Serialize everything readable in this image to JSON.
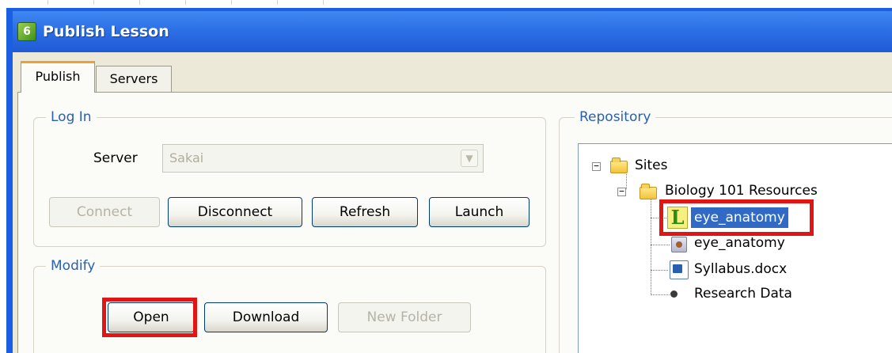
{
  "window": {
    "title": "Publish Lesson",
    "app_icon": "app-logo-icon",
    "app_icon_glyph": "6",
    "titlebar_color": "#2d70e6"
  },
  "tabs": [
    {
      "label": "Publish",
      "active": true
    },
    {
      "label": "Servers",
      "active": false
    }
  ],
  "login": {
    "group_label": "Log In",
    "server_label": "Server",
    "server_value": "Sakai",
    "buttons": {
      "connect": "Connect",
      "disconnect": "Disconnect",
      "refresh": "Refresh",
      "launch": "Launch"
    }
  },
  "modify": {
    "group_label": "Modify",
    "buttons": {
      "open": "Open",
      "download": "Download",
      "new_folder": "New Folder"
    }
  },
  "repository": {
    "group_label": "Repository",
    "tree": {
      "root": {
        "label": "Sites",
        "icon": "folder-icon",
        "expanded": true
      },
      "folder": {
        "label": "Biology 101 Resources",
        "icon": "folder-icon",
        "expanded": true
      },
      "items": [
        {
          "label": "eye_anatomy",
          "icon": "lesson-icon",
          "icon_glyph": "L",
          "selected": true
        },
        {
          "label": "eye_anatomy",
          "icon": "package-icon"
        },
        {
          "label": "Syllabus.docx",
          "icon": "word-document-icon"
        },
        {
          "label": "Research Data",
          "icon": "bullet-icon"
        }
      ]
    }
  },
  "annotations": {
    "highlight_color": "#e21515"
  }
}
